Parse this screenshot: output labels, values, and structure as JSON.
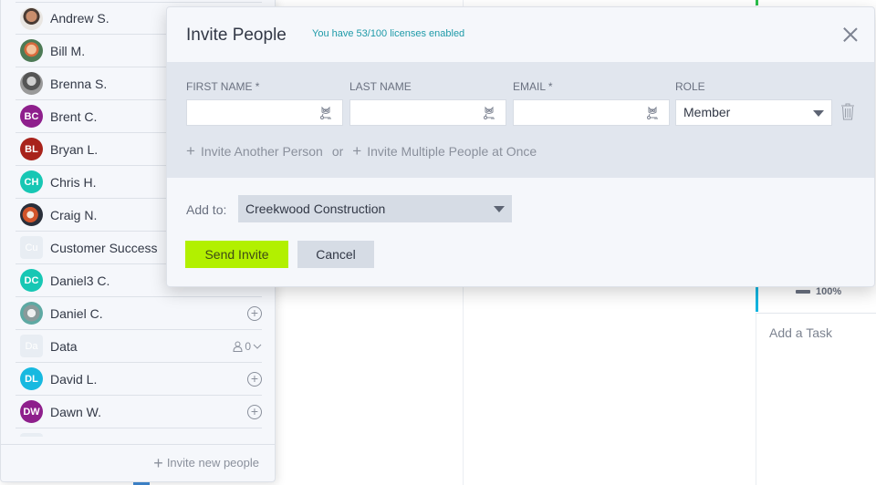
{
  "people_panel": {
    "people": [
      {
        "name": "Andrew S.",
        "initials": "",
        "avatar_type": "photo1",
        "color": "",
        "action": "none"
      },
      {
        "name": "Bill M.",
        "initials": "",
        "avatar_type": "photo2",
        "color": "",
        "action": "none"
      },
      {
        "name": "Brenna S.",
        "initials": "",
        "avatar_type": "photo3",
        "color": "",
        "action": "none"
      },
      {
        "name": "Brent C.",
        "initials": "BC",
        "avatar_type": "initials",
        "color": "#8e1f8c",
        "action": "none"
      },
      {
        "name": "Bryan L.",
        "initials": "BL",
        "avatar_type": "initials",
        "color": "#a8221b",
        "action": "none"
      },
      {
        "name": "Chris H.",
        "initials": "CH",
        "avatar_type": "initials",
        "color": "#17c7b4",
        "action": "none"
      },
      {
        "name": "Craig N.",
        "initials": "",
        "avatar_type": "photo4",
        "color": "",
        "action": "none"
      },
      {
        "name": "Customer Success",
        "initials": "Cu",
        "avatar_type": "team",
        "color": "",
        "action": "none"
      },
      {
        "name": "Daniel3 C.",
        "initials": "DC",
        "avatar_type": "initials",
        "color": "#17c7b4",
        "action": "none"
      },
      {
        "name": "Daniel C.",
        "initials": "",
        "avatar_type": "photo5",
        "color": "",
        "action": "add"
      },
      {
        "name": "Data",
        "initials": "Da",
        "avatar_type": "team",
        "color": "",
        "action": "team",
        "member_count": "0"
      },
      {
        "name": "David L.",
        "initials": "DL",
        "avatar_type": "initials",
        "color": "#17b9e0",
        "action": "add"
      },
      {
        "name": "Dawn W.",
        "initials": "DW",
        "avatar_type": "initials",
        "color": "#8e1f8c",
        "action": "add"
      }
    ],
    "invite_new_label": "Invite new people"
  },
  "modal": {
    "title": "Invite People",
    "license_note": "You have 53/100 licenses enabled",
    "fields": {
      "first_name_label": "FIRST NAME *",
      "last_name_label": "LAST NAME",
      "email_label": "EMAIL *",
      "role_label": "ROLE",
      "first_name_value": "",
      "last_name_value": "",
      "email_value": "",
      "role_value": "Member"
    },
    "invite_another": "Invite Another Person",
    "or_text": "or",
    "invite_multiple": "Invite Multiple People at Once",
    "add_to_label": "Add to:",
    "add_to_value": "Creekwood Construction",
    "send_label": "Send Invite",
    "cancel_label": "Cancel"
  },
  "board": {
    "task_progress": "100%",
    "add_task_label": "Add a Task"
  }
}
